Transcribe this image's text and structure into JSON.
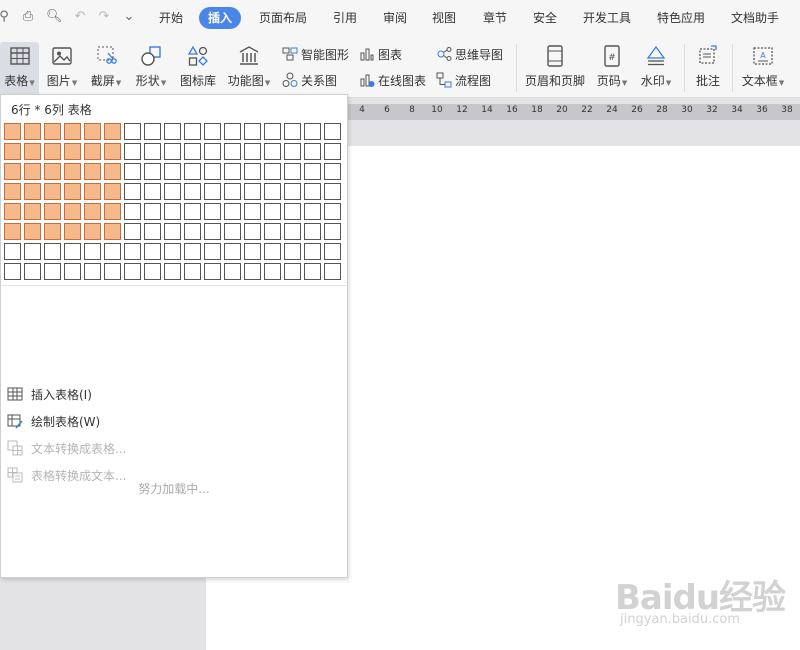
{
  "menubar": {
    "tabs": [
      {
        "label": "开始"
      },
      {
        "label": "插入"
      },
      {
        "label": "页面布局"
      },
      {
        "label": "引用"
      },
      {
        "label": "审阅"
      },
      {
        "label": "视图"
      },
      {
        "label": "章节"
      },
      {
        "label": "安全"
      },
      {
        "label": "开发工具"
      },
      {
        "label": "特色应用"
      },
      {
        "label": "文档助手"
      }
    ],
    "active_tab": "插入"
  },
  "ribbon": {
    "table": "表格",
    "picture": "图片",
    "screenshot": "截屏",
    "shape": "形状",
    "icon_library": "图标库",
    "function_chart": "功能图",
    "smart_shape": "智能图形",
    "chart": "图表",
    "mind_map": "思维导图",
    "relation_chart": "关系图",
    "online_chart": "在线图表",
    "flowchart": "流程图",
    "header_footer": "页眉和页脚",
    "page_number": "页码",
    "watermark": "水印",
    "comment": "批注",
    "textbox": "文本框"
  },
  "ruler": {
    "numbers": [
      "4",
      "6",
      "8",
      "10",
      "12",
      "14",
      "16",
      "18",
      "20",
      "22",
      "24",
      "26",
      "28",
      "30",
      "32",
      "34",
      "36",
      "38"
    ]
  },
  "dropdown": {
    "grid_title": "6行 * 6列 表格",
    "grid_cols": 17,
    "grid_rows": 8,
    "selected_rows": 6,
    "selected_cols": 6,
    "items": [
      {
        "label": "插入表格(I)",
        "enabled": true
      },
      {
        "label": "绘制表格(W)",
        "enabled": true
      },
      {
        "label": "文本转换成表格...",
        "enabled": false
      },
      {
        "label": "表格转换成文本...",
        "enabled": false
      }
    ],
    "loading": "努力加载中..."
  },
  "watermark": {
    "logo": "Baidu经验",
    "url": "jingyan.baidu.com"
  },
  "colors": {
    "accent": "#4a86e8",
    "grid_selected": "#f5b98c"
  }
}
